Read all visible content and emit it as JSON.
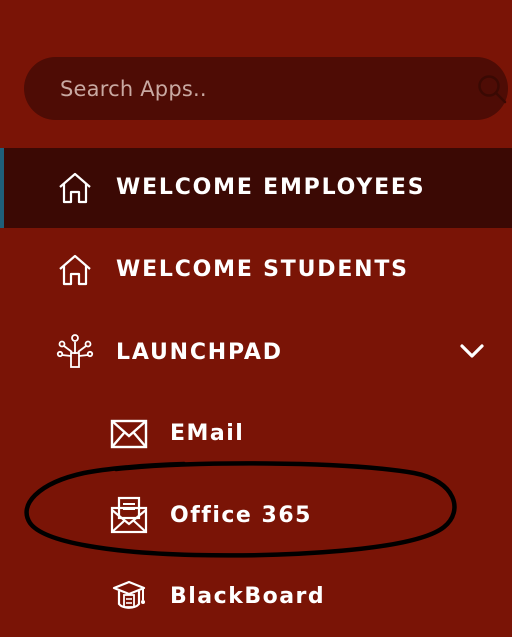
{
  "search": {
    "placeholder": "Search Apps.."
  },
  "nav": {
    "welcome_employees": {
      "label": "WELCOME EMPLOYEES",
      "icon": "home-icon",
      "active": true
    },
    "welcome_students": {
      "label": "WELCOME STUDENTS",
      "icon": "home-icon"
    },
    "launchpad": {
      "label": "LAUNCHPAD",
      "icon": "launchpad-icon",
      "expanded": true
    },
    "sub_items": [
      {
        "label": "EMail",
        "icon": "mail-icon"
      },
      {
        "label": "Office 365",
        "icon": "office365-icon",
        "highlighted": true
      },
      {
        "label": "BlackBoard",
        "icon": "blackboard-icon"
      }
    ]
  },
  "colors": {
    "background": "#7a1406",
    "search_background": "#4e0c05",
    "active_background": "#3b0904",
    "active_indicator": "#1f5f7a",
    "text": "#ffffff",
    "annotation": "#000000"
  }
}
